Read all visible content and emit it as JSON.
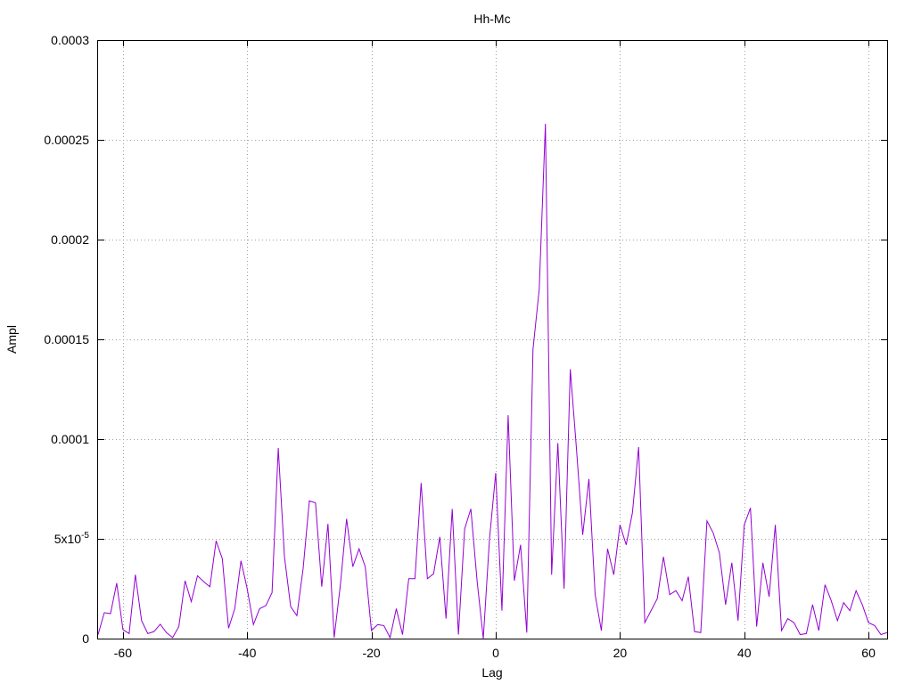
{
  "chart_data": {
    "type": "line",
    "title": "Hh-Mc",
    "xlabel": "Lag",
    "ylabel": "Ampl",
    "xlim": [
      -64,
      63
    ],
    "ylim": [
      0,
      0.0003
    ],
    "grid": true,
    "x_ticks": [
      -60,
      -40,
      -20,
      0,
      20,
      40,
      60
    ],
    "x_tick_labels": [
      "-60",
      "-40",
      "-20",
      "0",
      "20",
      "40",
      "60"
    ],
    "y_ticks": [
      0,
      5e-05,
      0.0001,
      0.00015,
      0.0002,
      0.00025,
      0.0003
    ],
    "y_tick_labels": [
      "0",
      "5x10-5",
      "0.0001",
      "0.00015",
      "0.0002",
      "0.00025",
      "0.0003"
    ],
    "y_tick_label_exponent": "-5",
    "series": [
      {
        "color": "#9400d3",
        "x": [
          -64,
          -63,
          -62,
          -61,
          -60,
          -59,
          -58,
          -57,
          -56,
          -55,
          -54,
          -53,
          -52,
          -51,
          -50,
          -49,
          -48,
          -47,
          -46,
          -45,
          -44,
          -43,
          -42,
          -41,
          -40,
          -39,
          -38,
          -37,
          -36,
          -35,
          -34,
          -33,
          -32,
          -31,
          -30,
          -29,
          -28,
          -27,
          -26,
          -25,
          -24,
          -23,
          -22,
          -21,
          -20,
          -19,
          -18,
          -17,
          -16,
          -15,
          -14,
          -13,
          -12,
          -11,
          -10,
          -9,
          -8,
          -7,
          -6,
          -5,
          -4,
          -3,
          -2,
          -1,
          0,
          1,
          2,
          3,
          4,
          5,
          6,
          7,
          8,
          9,
          10,
          11,
          12,
          13,
          14,
          15,
          16,
          17,
          18,
          19,
          20,
          21,
          22,
          23,
          24,
          25,
          26,
          27,
          28,
          29,
          30,
          31,
          32,
          33,
          34,
          35,
          36,
          37,
          38,
          39,
          40,
          41,
          42,
          43,
          44,
          45,
          46,
          47,
          48,
          49,
          50,
          51,
          52,
          53,
          54,
          55,
          56,
          57,
          58,
          59,
          60,
          61,
          62,
          63
        ],
        "values": [
          2e-06,
          1.3e-05,
          1.25e-05,
          2.78e-05,
          4.5e-06,
          2.5e-06,
          3.2e-05,
          9e-06,
          2.5e-06,
          3.5e-06,
          7.2e-06,
          3e-06,
          5e-07,
          6e-06,
          2.9e-05,
          1.85e-05,
          3.15e-05,
          2.85e-05,
          2.6e-05,
          4.9e-05,
          4e-05,
          5.2e-06,
          1.5e-05,
          3.9e-05,
          2.5e-05,
          7e-06,
          1.5e-05,
          1.65e-05,
          2.3e-05,
          9.55e-05,
          4.1e-05,
          1.6e-05,
          1.15e-05,
          3.5e-05,
          6.9e-05,
          6.8e-05,
          2.6e-05,
          5.75e-05,
          5e-07,
          2.7e-05,
          6e-05,
          3.6e-05,
          4.5e-05,
          3.6e-05,
          4e-06,
          7e-06,
          6.5e-06,
          5e-07,
          1.5e-05,
          2e-06,
          3e-05,
          3e-05,
          7.8e-05,
          3e-05,
          3.25e-05,
          5.1e-05,
          1e-05,
          6.5e-05,
          2e-06,
          5.5e-05,
          6.5e-05,
          2.9e-05,
          0.0,
          5e-05,
          8.3e-05,
          1.4e-05,
          0.000112,
          2.9e-05,
          4.7e-05,
          3e-06,
          0.000145,
          0.000175,
          0.000258,
          3.2e-05,
          9.8e-05,
          2.5e-05,
          0.000135,
          9.5e-05,
          5.2e-05,
          8e-05,
          2.2e-05,
          4e-06,
          4.5e-05,
          3.2e-05,
          5.7e-05,
          4.7e-05,
          6.3e-05,
          9.6e-05,
          8e-06,
          1.4e-05,
          2e-05,
          4.1e-05,
          2.2e-05,
          2.4e-05,
          1.9e-05,
          3.1e-05,
          3.5e-06,
          3e-06,
          5.9e-05,
          5.3e-05,
          4.3e-05,
          1.7e-05,
          3.8e-05,
          9e-06,
          5.7e-05,
          6.55e-05,
          6e-06,
          3.8e-05,
          2.1e-05,
          5.7e-05,
          4e-06,
          1e-05,
          8e-06,
          2e-06,
          2.5e-06,
          1.7e-05,
          4e-06,
          2.7e-05,
          1.9e-05,
          9e-06,
          1.8e-05,
          1.4e-05,
          2.4e-05,
          1.7e-05,
          8e-06,
          6.5e-06,
          2e-06,
          3e-06
        ]
      }
    ]
  }
}
